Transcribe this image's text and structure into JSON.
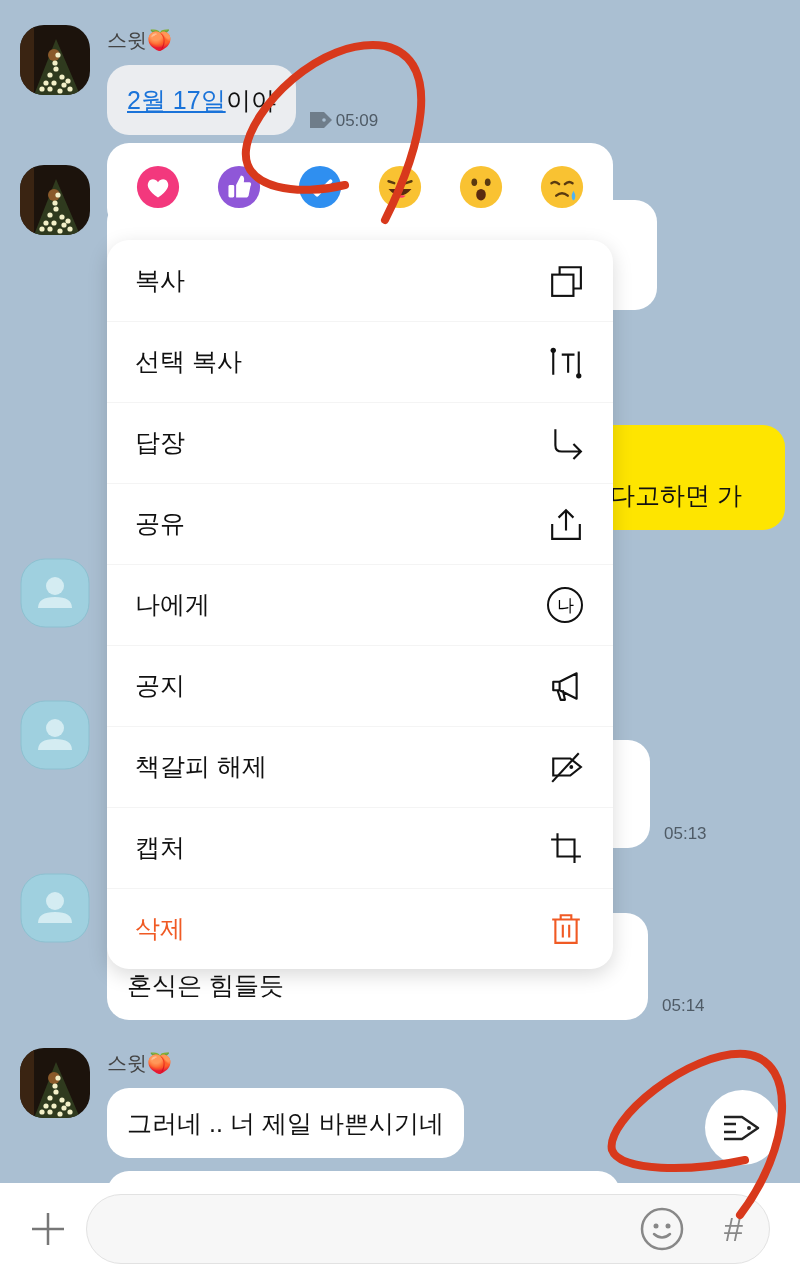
{
  "messages": [
    {
      "kind": "received",
      "avatar_photo": true,
      "sender": "스윗🍑",
      "parts": [
        {
          "text": "2월 17일",
          "link": true
        },
        {
          "text": "이야",
          "link": false
        }
      ],
      "time": "05:09",
      "bookmarked": true
    },
    {
      "kind": "received",
      "avatar_photo": true
    },
    {
      "kind": "sent",
      "parts": [
        {
          "text": "다고하면 가",
          "link": false
        }
      ]
    },
    {
      "kind": "received",
      "avatar_photo": false
    },
    {
      "kind": "received",
      "avatar_photo": false,
      "time": "05:13"
    },
    {
      "kind": "received",
      "avatar_photo": false,
      "parts": [
        {
          "text": "혼식은 힘들듯",
          "link": false
        }
      ],
      "time": "05:14"
    },
    {
      "kind": "received",
      "avatar_photo": true,
      "sender": "스윗🍑",
      "parts": [
        {
          "text": "그러네 .. 너 제일 바쁜시기네",
          "link": false
        }
      ]
    },
    {
      "kind": "received"
    }
  ],
  "context_menu": {
    "items": [
      {
        "label": "복사",
        "destructive": false
      },
      {
        "label": "선택 복사",
        "destructive": false
      },
      {
        "label": "답장",
        "destructive": false
      },
      {
        "label": "공유",
        "destructive": false
      },
      {
        "label": "나에게",
        "destructive": false,
        "icon_text": "나"
      },
      {
        "label": "공지",
        "destructive": false
      },
      {
        "label": "책갈피 해제",
        "destructive": false
      },
      {
        "label": "캡처",
        "destructive": false
      },
      {
        "label": "삭제",
        "destructive": true
      }
    ]
  },
  "input_bar": {
    "hash_button": "#"
  }
}
